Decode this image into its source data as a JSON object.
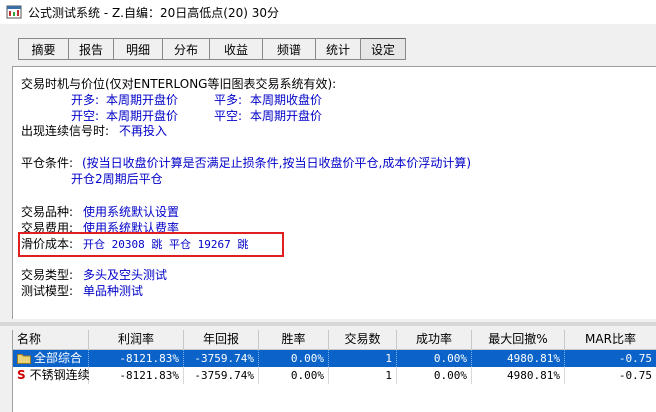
{
  "window": {
    "title": "公式测试系统 - Z.自编：20日高低点(20) 30分"
  },
  "tabs": [
    {
      "label": "摘要"
    },
    {
      "label": "报告"
    },
    {
      "label": "明细"
    },
    {
      "label": "分布"
    },
    {
      "label": "收益"
    },
    {
      "label": "频谱"
    },
    {
      "label": "统计"
    },
    {
      "label": "设定",
      "active": true
    }
  ],
  "settings": {
    "timing_label": "交易时机与价位(仅对ENTERLONG等旧图表交易系统有效):",
    "open_long_label": "开多:",
    "open_long_value": "本周期开盘价",
    "close_long_label": "平多:",
    "close_long_value": "本周期收盘价",
    "open_short_label": "开空:",
    "open_short_value": "本周期开盘价",
    "close_short_label": "平空:",
    "close_short_value": "本周期开盘价",
    "signal_label": "出现连续信号时:",
    "signal_value": "不再投入",
    "close_cond_label": "平仓条件:",
    "close_cond_value": "(按当日收盘价计算是否满足止损条件,按当日收盘价平仓,成本价浮动计算)",
    "close_rule_value": "开仓2周期后平仓",
    "variety_label": "交易品种:",
    "variety_value": "使用系统默认设置",
    "fee_label": "交易费用:",
    "fee_value": "使用系统默认费率",
    "slippage_label": "滑价成本:",
    "slippage_value": "开仓 20308 跳  平仓 19267 跳",
    "trade_type_label": "交易类型:",
    "trade_type_value": "多头及空头测试",
    "test_model_label": "测试模型:",
    "test_model_value": "单品种测试"
  },
  "table": {
    "headers": [
      "名称",
      "利润率",
      "年回报",
      "胜率",
      "交易数",
      "成功率",
      "最大回撤%",
      "MAR比率"
    ],
    "rows": [
      {
        "name": "全部综合",
        "icon": "folder-icon",
        "profit": "-8121.83%",
        "annual": "-3759.74%",
        "win": "0.00%",
        "trades": "1",
        "success": "0.00%",
        "drawdown": "4980.81%",
        "mar": "-0.75"
      },
      {
        "name": "不锈钢连续",
        "icon": "s-icon",
        "profit": "-8121.83%",
        "annual": "-3759.74%",
        "win": "0.00%",
        "trades": "1",
        "success": "0.00%",
        "drawdown": "4980.81%",
        "mar": "-0.75"
      }
    ]
  },
  "colors": {
    "value_text": "#0000c8",
    "selection": "#0b63c9",
    "highlight_box": "#e02020"
  }
}
